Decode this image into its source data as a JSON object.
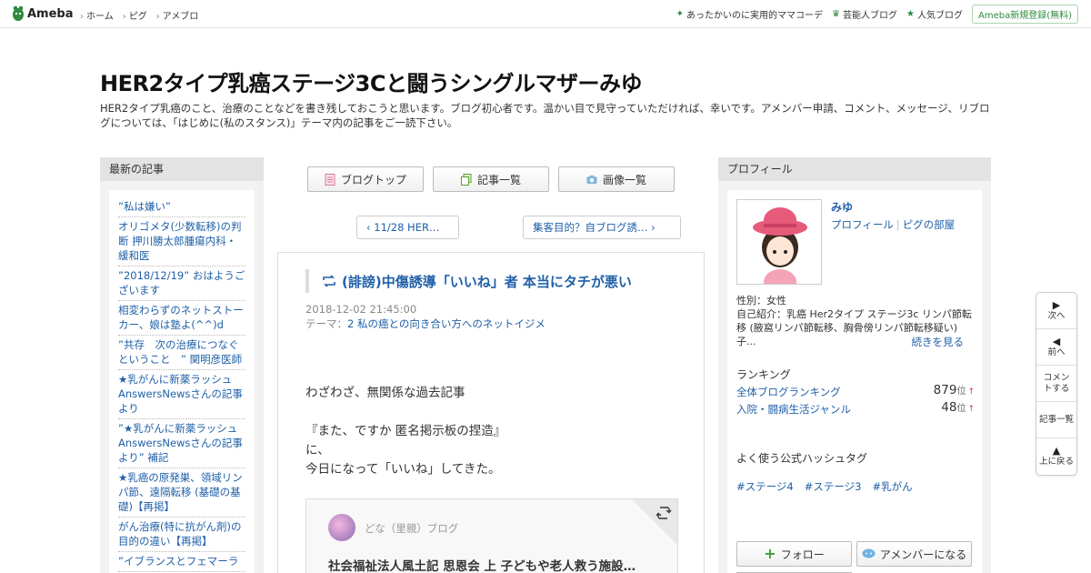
{
  "header": {
    "logo": "Ameba",
    "nav": [
      "ホーム",
      "ピグ",
      "アメブロ"
    ],
    "right_links": [
      {
        "icon": "green-sparkle-icon",
        "label": "あったかいのに実用的ママコーデ"
      },
      {
        "icon": "crown-icon",
        "label": "芸能人ブログ"
      },
      {
        "icon": "star-icon",
        "label": "人気ブログ"
      }
    ],
    "register": "Ameba新規登録(無料)"
  },
  "blog": {
    "title": "HER2タイプ乳癌ステージ3Cと闘うシングルマザーみゆ",
    "description": "HER2タイプ乳癌のこと、治療のことなどを書き残しておこうと思います。ブログ初心者です。温かい目で見守っていただければ、幸いです。アメンバー申請、コメント、メッセージ、リブログについては、「はじめに(私のスタンス)」テーマ内の記事をご一読下さい。"
  },
  "left": {
    "heading": "最新の記事",
    "articles": [
      "”私は嫌い”",
      "オリゴメタ(少数転移)の判断 押川勝太郎腫瘍内科・緩和医",
      "”2018/12/19” おはようございます",
      "相変わらずのネットストーカー、娘は塾よ(^^)d",
      "”共存　次の治療につなぐということ　” 関明彦医師",
      "★乳がんに新薬ラッシュ AnswersNewsさんの記事より",
      "”★乳がんに新薬ラッシュ AnswersNewsさんの記事より” 補記",
      "★乳癌の原発巣、領域リンパ節、遠隔転移 (基礎の基礎)【再掲】",
      "がん治療(特に抗がん剤)の目的の違い【再掲】",
      "”イブランスとフェマーラ"
    ]
  },
  "center": {
    "buttons": [
      {
        "icon": "notepad-icon",
        "label": "ブログトップ"
      },
      {
        "icon": "documents-icon",
        "label": "記事一覧"
      },
      {
        "icon": "camera-icon",
        "label": "画像一覧"
      }
    ],
    "prev": "11/28 HER…",
    "next": "集客目的？自ブログ誘…",
    "article": {
      "title": "(誹謗)中傷誘導「いいね」者 本当にタチが悪い",
      "date": "2018-12-02 21:45:00",
      "theme_prefix": "テーマ：",
      "theme": "2 私の癌との向き合い方へのネットイジメ",
      "body": [
        "わざわざ、無関係な過去記事",
        "",
        "『また、ですか  匿名掲示板の捏造』",
        "に、",
        "今日になって「いいね」してきた。"
      ],
      "card": {
        "source": "どな（里親）ブログ",
        "title": "社会福祉法人風土記 思恩会 上 子どもや老人救う施設…"
      }
    }
  },
  "right": {
    "heading": "プロフィール",
    "name": "みゆ",
    "links": [
      "プロフィール",
      "ピグの部屋"
    ],
    "gender": "性別：女性",
    "intro": "自己紹介：乳癌 Her2タイプ ステージ3c リンパ節転移 (腋窩リンパ節転移、胸骨傍リンパ節転移疑い) 子...",
    "more": "続きを見る",
    "ranking_title": "ランキング",
    "rankings": [
      {
        "name": "全体ブログランキング",
        "value": "879",
        "unit": "位",
        "trend": "↑"
      },
      {
        "name": "入院・闘病生活ジャンル",
        "value": "48",
        "unit": "位",
        "trend": "↑"
      }
    ],
    "hashtag_title": "よく使う公式ハッシュタグ",
    "hashtags": [
      "#ステージ4",
      "#ステージ3",
      "#乳がん"
    ],
    "follow": "フォロー",
    "member": "アメンバーになる"
  },
  "sidenav": [
    {
      "icon": "play-right-icon",
      "label": "次へ"
    },
    {
      "icon": "play-left-icon",
      "label": "前へ"
    },
    {
      "icon": "",
      "label": "コメントする"
    },
    {
      "icon": "",
      "label": "記事一覧"
    },
    {
      "icon": "triangle-up-icon",
      "label": "上に戻る"
    }
  ],
  "colors": {
    "link": "#2060a8",
    "accent_green": "#2d8a3e",
    "sidebar_bg": "#f2f2f2"
  }
}
